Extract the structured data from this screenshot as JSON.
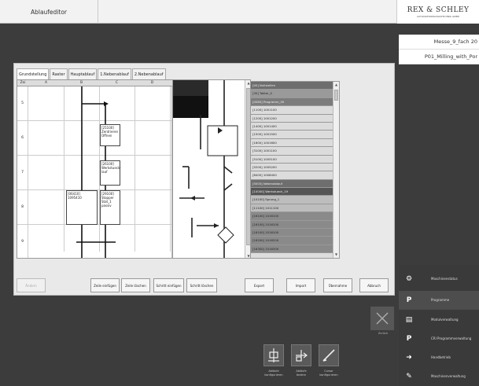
{
  "app": {
    "title": "Ablaufeditor"
  },
  "logo": {
    "name": "REX & SCHLEY",
    "tagline": "AUTOMATISIERUNGSTECHNIK GMBH"
  },
  "project": {
    "line1": "Messe_9_fach 20",
    "line2": "P01_Milling_with_Por"
  },
  "tabs": [
    "Grundstellung",
    "Raster",
    "Hauptablauf",
    "1.Nebenablauf",
    "2.Nebenablauf"
  ],
  "grid": {
    "headers": [
      "Zei",
      "A",
      "B",
      "C",
      "D"
    ],
    "rows": [
      "5",
      "6",
      "7",
      "8",
      "9"
    ],
    "cells": [
      {
        "id": "c6",
        "text": "[25100]\nZentrieren\nOffnen"
      },
      {
        "id": "c7",
        "text": "[26100]\nWerkstueck-\nlauf"
      },
      {
        "id": "b8",
        "text": "[06410]\n1095410"
      },
      {
        "id": "c8",
        "text": "[29100]\nStopper\nStat_1\npassiv"
      }
    ]
  },
  "operations": [
    "[00] Nullstellen",
    "[30] Takter_0",
    "[0080] Programm_00",
    "[1100] 1001100",
    "[1200] 1001200",
    "[1400] 1001400",
    "[1500] 1001500",
    "[1600] 1001600",
    "[3100] 1001100",
    "[5100] 1005100",
    "[5200] 1005200",
    "[8400] 1008400",
    "[5000] Nebenablauf",
    "[10000] Werkstueck_19",
    "[10100] Sprung_1",
    "[11100] 1011100",
    "[16100] 1016100",
    "[16100] 1016100",
    "[16100] 1016100",
    "[16200] 1016200",
    "[16300] 1016300"
  ],
  "buttons": [
    {
      "label": "Ändern",
      "disabled": true
    },
    {
      "label": "Zeile einfügen"
    },
    {
      "label": "Zeile löschen"
    },
    {
      "label": "Schritt einfügen"
    },
    {
      "label": "Schritt löschen"
    },
    {
      "label": "Export"
    },
    {
      "label": "Import"
    },
    {
      "label": "Übernahme"
    },
    {
      "label": "Abbruch"
    }
  ],
  "nav": [
    {
      "label": "Maschinenstatus",
      "icon": "gears-icon"
    },
    {
      "label": "Programme",
      "icon": "program-icon",
      "active": true
    },
    {
      "label": "Modulverwaltung",
      "icon": "module-icon"
    },
    {
      "label": "CRI Programmverwaltung",
      "icon": "prog-manage-icon"
    },
    {
      "label": "Handbetrieb",
      "icon": "hand-mode-icon"
    },
    {
      "label": "Maschinenverwaltung",
      "icon": "wrench-icon"
    }
  ],
  "cancel": {
    "label": "Zurück"
  },
  "tools": [
    {
      "label": "Abläufe\nkonfigurieren"
    },
    {
      "label": "Abläufe\nändern"
    },
    {
      "label": "Cursor\nkonfigurieren"
    }
  ]
}
